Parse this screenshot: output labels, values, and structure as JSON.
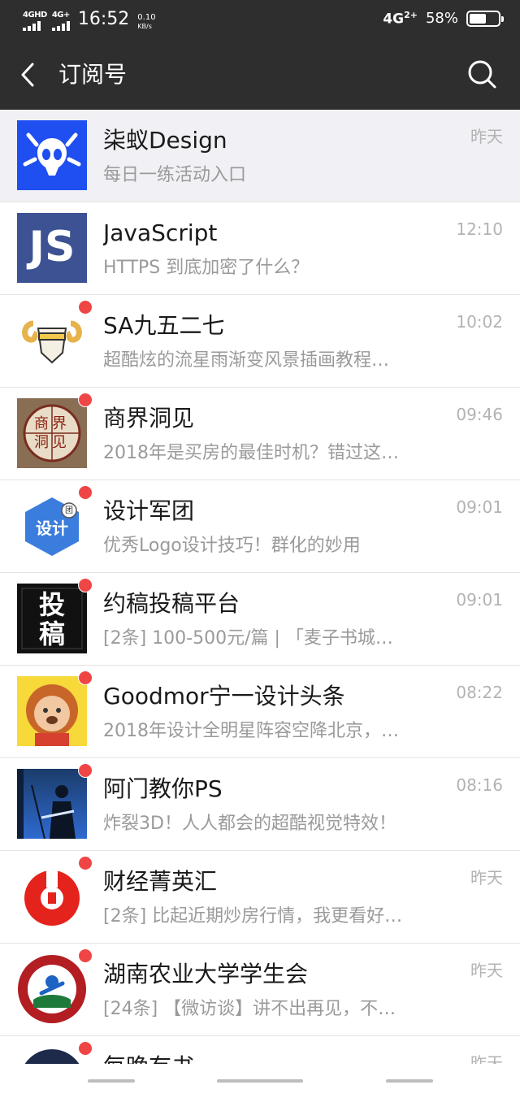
{
  "status_bar": {
    "signal1_label": "4GHD",
    "signal2_label": "4G+",
    "time": "16:52",
    "speed_value": "0.10",
    "speed_unit": "KB/s",
    "network": "4G",
    "network_sub": "2+",
    "battery_pct": "58%",
    "battery_level": 0.58
  },
  "navbar": {
    "title": "订阅号",
    "back_icon": "chevron-left-icon",
    "search_icon": "search-icon"
  },
  "colors": {
    "topbar": "#2e2e2e",
    "unread_dot": "#f04545",
    "pinned_bg": "#f0f0f5",
    "muted_text": "#9a9a9a"
  },
  "items": [
    {
      "name": "柒蚁Design",
      "preview": "每日一练活动入口",
      "time": "昨天",
      "unread": false,
      "pinned": true,
      "avatar": "ant-logo"
    },
    {
      "name": "JavaScript",
      "preview": "HTTPS 到底加密了什么？",
      "time": "12:10",
      "unread": false,
      "pinned": false,
      "avatar": "js-logo",
      "avatar_text": "JS"
    },
    {
      "name": "SA九五二七",
      "preview": "超酷炫的流星雨渐变风景插画教程…",
      "time": "10:02",
      "unread": true,
      "pinned": false,
      "avatar": "ram-skull-logo"
    },
    {
      "name": "商界洞见",
      "preview": "2018年是买房的最佳时机？错过这…",
      "time": "09:46",
      "unread": true,
      "pinned": false,
      "avatar": "seal-logo",
      "avatar_text": "商界洞见"
    },
    {
      "name": "设计军团",
      "preview": "优秀Logo设计技巧！群化的妙用",
      "time": "09:01",
      "unread": true,
      "pinned": false,
      "avatar": "hexagon-logo",
      "avatar_text": "设计",
      "avatar_badge": "团"
    },
    {
      "name": "约稿投稿平台",
      "preview": "[2条] 100-500元/篇 | 「麦子书城…",
      "time": "09:01",
      "unread": true,
      "pinned": false,
      "avatar": "calligraphy-logo",
      "avatar_text": "投稿"
    },
    {
      "name": "Goodmor宁一设计头条",
      "preview": "2018年设计全明星阵容空降北京，…",
      "time": "08:22",
      "unread": true,
      "pinned": false,
      "avatar": "lion-logo"
    },
    {
      "name": "阿门教你PS",
      "preview": "炸裂3D！人人都会的超酷视觉特效！",
      "time": "08:16",
      "unread": true,
      "pinned": false,
      "avatar": "guitarist-photo"
    },
    {
      "name": "财经菁英汇",
      "preview": "[2条] 比起近期炒房行情，我更看好…",
      "time": "昨天",
      "unread": true,
      "pinned": false,
      "avatar": "red-coin-logo"
    },
    {
      "name": "湖南农业大学学生会",
      "preview": "[24条] 【微访谈】讲不出再见，不…",
      "time": "昨天",
      "unread": true,
      "pinned": false,
      "avatar": "university-emblem"
    },
    {
      "name": "每晚有书",
      "preview": "",
      "time": "昨天",
      "unread": true,
      "pinned": false,
      "avatar": "book-logo"
    }
  ]
}
